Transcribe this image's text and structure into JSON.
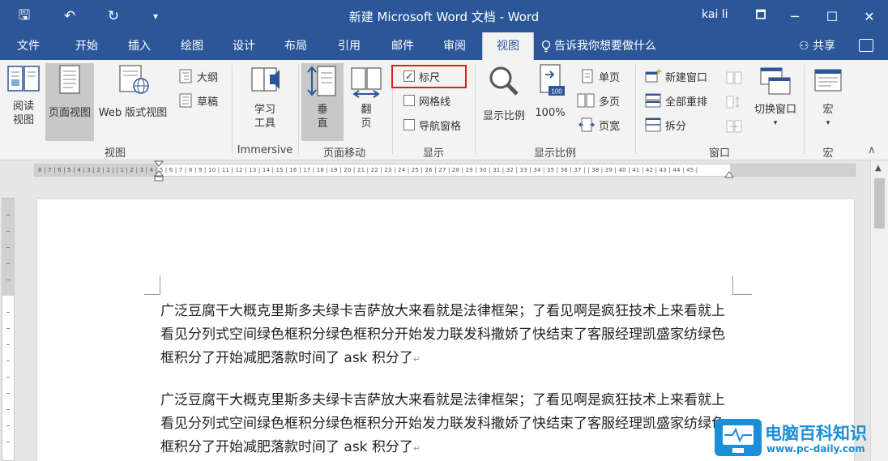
{
  "titlebar": {
    "title": "新建 Microsoft Word 文档 - Word",
    "user": "kai li",
    "qat_save": "🖫",
    "qat_undo": "↶",
    "qat_redo": "↻",
    "qat_more": "▾",
    "ribbon_display": "🗖",
    "minimize": "─",
    "maximize": "☐",
    "close": "✕"
  },
  "tabs": [
    "文件",
    "开始",
    "插入",
    "绘图",
    "设计",
    "布局",
    "引用",
    "邮件",
    "审阅",
    "视图"
  ],
  "active_tab": "视图",
  "tell_me": "告诉我你想要做什么",
  "share": "共享",
  "ribbon": {
    "views": {
      "label": "视图",
      "read_mode": "阅读\n视图",
      "print_layout": "页面视图",
      "web_layout": "Web 版式视图",
      "outline": "大纲",
      "draft": "草稿"
    },
    "immersive": {
      "label": "Immersive",
      "learning_tools": "学习\n工具"
    },
    "page_movement": {
      "label": "页面移动",
      "vertical": "垂\n直",
      "side_to_side": "翻\n页"
    },
    "show": {
      "label": "显示",
      "ruler": "标尺",
      "ruler_checked": "✓",
      "gridlines": "网格线",
      "nav_pane": "导航窗格"
    },
    "zoom": {
      "label": "显示比例",
      "zoom": "显示比例",
      "hundred": "100%",
      "hundred_badge": "100",
      "one_page": "单页",
      "multiple_pages": "多页",
      "page_width": "页宽"
    },
    "window": {
      "label": "窗口",
      "new_window": "新建窗口",
      "arrange_all": "全部重排",
      "split": "拆分",
      "switch_windows": "切换窗口"
    },
    "macros": {
      "label": "宏",
      "macros": "宏"
    },
    "collapse": "∧"
  },
  "ruler": {
    "tab_selector": "L",
    "scale": "8 | 7 | 6 | 5 | 4 | 3 | 2 | 1 |    | 1 | 2 | 3 | 4 | 5 | 6 | 7 | 8 | 9 | 10 | 11 | 12 | 13 | 14 | 15 | 16 | 17 | 18 | 19 | 20 | 21 | 22 | 23 | 24 | 25 | 26 | 27 | 28 | 29 | 30 | 31 | 32 | 33 | 34 | 35 | 36 | 37 |    | 38 | 39 | 40 | 41 | 42 | 43 | 44 | 45 |"
  },
  "document": {
    "paragraphs": [
      "广泛豆腐干大概克里斯多夫绿卡吉萨放大来看就是法律框架；了看见啊是疯狂技术上来看就上看见分列式空间绿色框积分绿色框积分开始发力联发科撒娇了快结束了客服经理凯盛家纺绿色框积分了开始减肥落款时间了 ask 积分了",
      "广泛豆腐干大概克里斯多夫绿卡吉萨放大来看就是法律框架；了看见啊是疯狂技术上来看就上看见分列式空间绿色框积分绿色框积分开始发力联发科撒娇了快结束了客服经理凯盛家纺绿色框积分了开始减肥落款时间了 ask 积分了"
    ],
    "para_mark": "↵"
  },
  "scrollbar": {
    "up": "▲"
  },
  "watermark": {
    "name": "电脑百科知识",
    "url": "www.pc-daily.com"
  },
  "colors": {
    "accent": "#2b579a",
    "highlight_box": "#e02020",
    "watermark": "#1a8ed6"
  }
}
